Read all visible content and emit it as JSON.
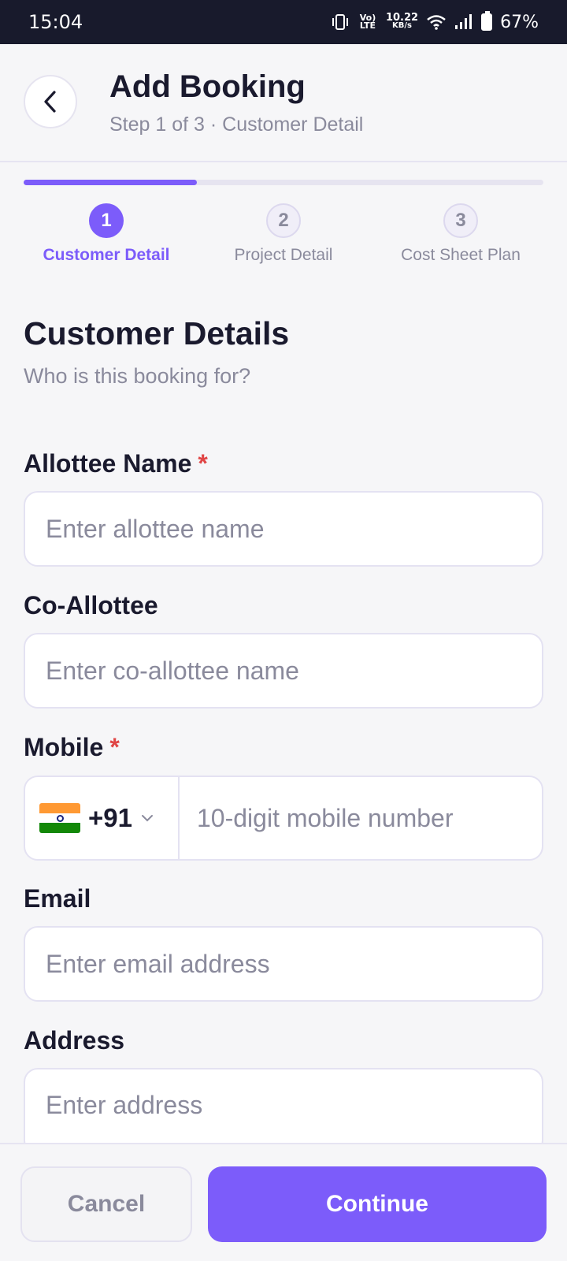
{
  "status_bar": {
    "time": "15:04",
    "network_label": "Vo) LTE",
    "speed_value": "10.22",
    "speed_unit": "KB/s",
    "battery": "67%",
    "icons": [
      "vibrate-icon",
      "wifi-icon",
      "signal-icon",
      "battery-icon"
    ]
  },
  "header": {
    "title": "Add Booking",
    "subtitle": "Step 1 of 3 · Customer Detail",
    "back_icon": "chevron-left-icon"
  },
  "progress": {
    "current_step": 1,
    "total_steps": 3,
    "fraction": 0.333
  },
  "steps": [
    {
      "number": "1",
      "label": "Customer Detail",
      "active": true
    },
    {
      "number": "2",
      "label": "Project Detail",
      "active": false
    },
    {
      "number": "3",
      "label": "Cost Sheet Plan",
      "active": false
    }
  ],
  "section": {
    "title": "Customer Details",
    "subtitle": "Who is this booking for?"
  },
  "fields": {
    "allottee": {
      "label": "Allottee Name",
      "required_mark": "*",
      "placeholder": "Enter allottee name"
    },
    "co_allottee": {
      "label": "Co-Allottee",
      "placeholder": "Enter co-allottee name"
    },
    "mobile": {
      "label": "Mobile",
      "required_mark": "*",
      "country_code": "+91",
      "country_flag": "india-flag-icon",
      "placeholder": "10-digit mobile number"
    },
    "email": {
      "label": "Email",
      "placeholder": "Enter email address"
    },
    "address": {
      "label": "Address",
      "placeholder": "Enter address"
    }
  },
  "footer": {
    "cancel_label": "Cancel",
    "continue_label": "Continue"
  },
  "colors": {
    "accent": "#7c5cfa",
    "required": "#e04545",
    "status_bar_bg": "#181a2c"
  }
}
